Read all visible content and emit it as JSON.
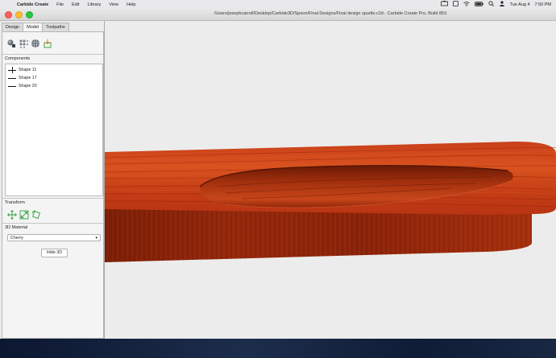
{
  "menubar": {
    "app_name": "Carbide Create",
    "items": [
      "File",
      "Edit",
      "Library",
      "View",
      "Help"
    ],
    "date": "Tue Aug 4",
    "time": "7:50 PM"
  },
  "window": {
    "title": "/Users/josephcarroll/Desktop/Carbide3D/Spoon/Final Designs/Final design spurtle.c2d - Carbide Create Pro, Build 853"
  },
  "tabs": [
    {
      "label": "Design",
      "active": false
    },
    {
      "label": "Model",
      "active": true
    },
    {
      "label": "Toolpaths",
      "active": false
    }
  ],
  "panel": {
    "components_label": "Components",
    "components": [
      {
        "name": "Shape 11",
        "icon": "plus"
      },
      {
        "name": "Shape 17",
        "icon": "line"
      },
      {
        "name": "Shape 20",
        "icon": "line"
      }
    ],
    "transform_label": "Transform",
    "material_label": "3D Material",
    "material_value": "Cherry",
    "hide3d_label": "Hide 3D"
  },
  "colors": {
    "wood_light": "#d2491f",
    "wood_dark": "#9c2608",
    "viewport_bg": "#ececec"
  }
}
